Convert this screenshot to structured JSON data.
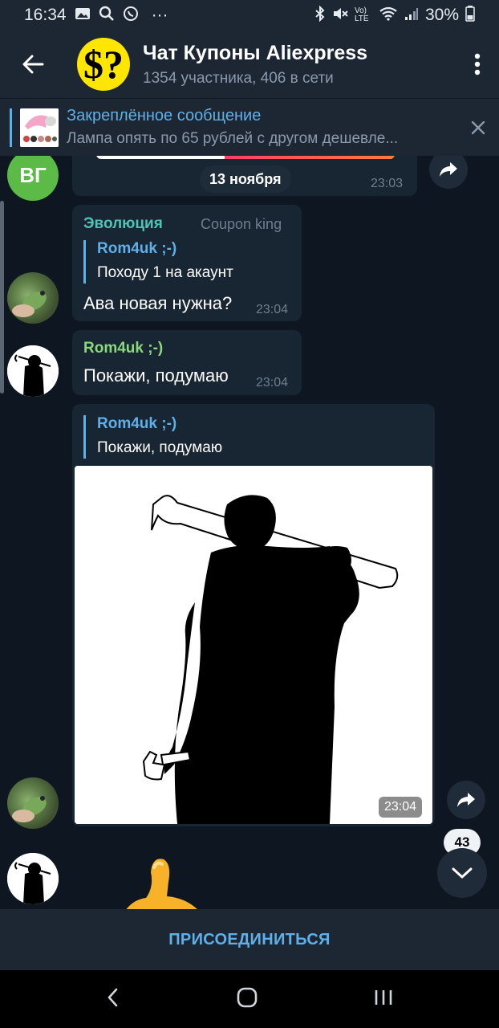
{
  "status_bar": {
    "time": "16:34",
    "dots": "···",
    "network_lte": "Vo) LTE",
    "battery": "30%"
  },
  "header": {
    "avatar_glyph": "$?",
    "title": "Чат Купоны Aliexpress",
    "subtitle": "1354 участника, 406 в сети"
  },
  "pinned": {
    "title": "Закреплённое сообщение",
    "text": "Лампа опять по 65 рублей с другом дешевле..."
  },
  "messages": [
    {
      "avatar_initials": "ВГ",
      "date_label": "13 ноября",
      "time": "23:03"
    },
    {
      "sender": "Эволюция",
      "role": "Coupon king",
      "reply_name": "Rom4uk ;-)",
      "reply_text": "Походу 1 на акаунт",
      "text": "Ава новая нужна?",
      "time": "23:04"
    },
    {
      "sender": "Rom4uk ;-)",
      "text": "Покажи, подумаю",
      "time": "23:04"
    },
    {
      "reply_name": "Rom4uk ;-)",
      "reply_text": "Покажи, подумаю",
      "time": "23:04"
    }
  ],
  "unread_count": "43",
  "join_label": "ПРИСОЕДИНИТЬСЯ",
  "colors": {
    "background": "#0e1621",
    "bar": "#1d2733",
    "bubble": "#182533",
    "accent": "#5fb0e8",
    "sender_evolution": "#4fc3b8",
    "sender_romuk": "#8bd97a"
  },
  "icons": {
    "back": "back-arrow-icon",
    "menu": "more-vert-icon",
    "close": "close-icon",
    "share": "share-icon",
    "scroll_down": "chevron-down-icon"
  }
}
